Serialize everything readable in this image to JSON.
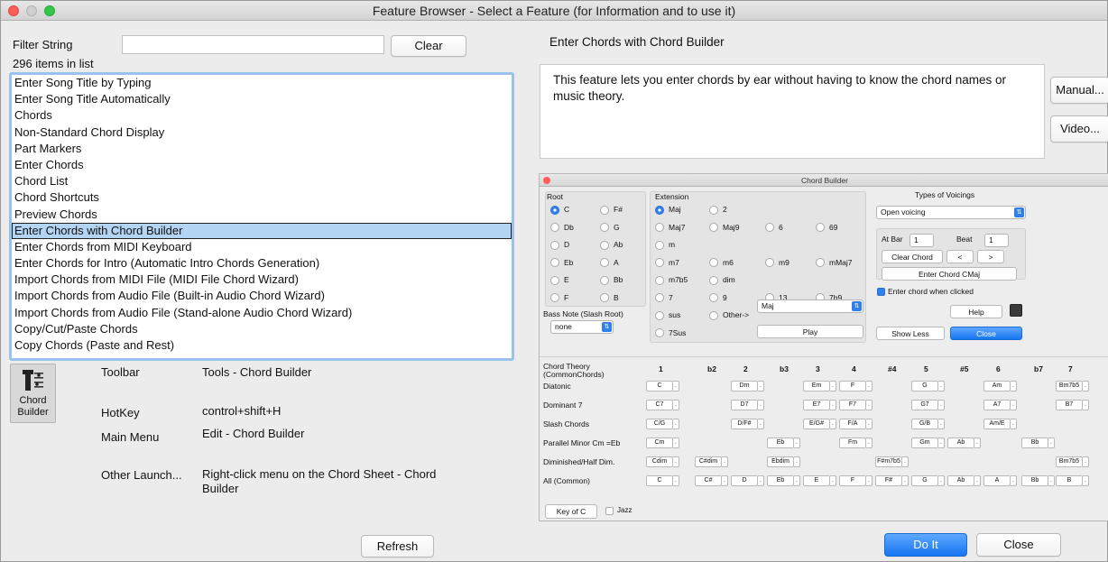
{
  "window": {
    "title": "Feature Browser - Select a Feature (for Information and to use it)"
  },
  "filter": {
    "label": "Filter String",
    "value": "",
    "clear_label": "Clear",
    "count_text": "296 items in list"
  },
  "feature_list": [
    "Enter Song Title by Typing",
    "Enter Song Title Automatically",
    "Chords",
    "Non-Standard Chord Display",
    "Part Markers",
    "Enter Chords",
    "Chord List",
    "Chord Shortcuts",
    "Preview Chords",
    "Enter Chords with Chord Builder",
    "Enter Chords from MIDI Keyboard",
    "Enter Chords for Intro (Automatic Intro Chords Generation)",
    "Import Chords from MIDI File (MIDI File Chord Wizard)",
    "Import Chords from Audio File (Built-in Audio Chord Wizard)",
    "Import Chords from Audio File (Stand-alone Audio Chord Wizard)",
    "Copy/Cut/Paste Chords",
    "Copy Chords (Paste and Rest)"
  ],
  "selected_index": 9,
  "detail": {
    "title": "Enter Chords with Chord Builder",
    "description": "This feature lets you enter chords by ear without having to know the chord names or music theory.",
    "manual_label": "Manual...",
    "video_label": "Video..."
  },
  "info": {
    "icon_label": "Chord Builder",
    "toolbar_label": "Toolbar",
    "toolbar_value": "Tools - Chord Builder",
    "hotkey_label": "HotKey",
    "hotkey_value": "control+shift+H",
    "mainmenu_label": "Main Menu",
    "mainmenu_value": "Edit - Chord Builder",
    "other_label": "Other Launch...",
    "other_value": "Right-click menu on the Chord Sheet - Chord Builder"
  },
  "buttons": {
    "refresh": "Refresh",
    "doit": "Do It",
    "close": "Close"
  },
  "chord_builder": {
    "title": "Chord Builder",
    "root_label": "Root",
    "roots": [
      "C",
      "F#",
      "Db",
      "G",
      "D",
      "Ab",
      "Eb",
      "A",
      "E",
      "Bb",
      "F",
      "B"
    ],
    "extension_label": "Extension",
    "extensions": [
      "Maj",
      "2",
      "Maj7",
      "Maj9",
      "6",
      "69",
      "m",
      "m7",
      "m6",
      "m9",
      "mMaj7",
      "m7b5",
      "dim",
      "7",
      "9",
      "13",
      "7b9",
      "sus",
      "Other->",
      "7Sus"
    ],
    "other_value": "Maj",
    "bass_label": "Bass Note (Slash Root)",
    "bass_value": "none",
    "play_label": "Play",
    "voicings_label": "Types of Voicings",
    "voicing_value": "Open voicing",
    "at_bar_label": "At Bar",
    "at_bar_value": "1",
    "beat_label": "Beat",
    "beat_value": "1",
    "clear_chord": "Clear Chord",
    "prev": "<",
    "next": ">",
    "enter_chord": "Enter Chord CMaj",
    "enter_when_clicked": "Enter chord when clicked",
    "help": "Help",
    "show_less": "Show Less",
    "close": "Close",
    "theory_label": "Chord Theory (CommonChords)",
    "degrees": [
      "1",
      "b2",
      "2",
      "b3",
      "3",
      "4",
      "#4",
      "5",
      "#5",
      "6",
      "b7",
      "7"
    ],
    "row_labels": [
      "Diatonic",
      "Dominant 7",
      "Slash Chords",
      "Parallel Minor Cm =Eb",
      "Diminished/Half Dim.",
      "All (Common)"
    ],
    "rows": [
      [
        "C",
        "",
        "Dm",
        "",
        "Em",
        "F",
        "",
        "G",
        "",
        "Am",
        "",
        "Bm7b5"
      ],
      [
        "C7",
        "",
        "D7",
        "",
        "E7",
        "F7",
        "",
        "G7",
        "",
        "A7",
        "",
        "B7"
      ],
      [
        "C/G",
        "",
        "D/F#",
        "",
        "E/G#",
        "F/A",
        "",
        "G/B",
        "",
        "Am/E",
        "",
        ""
      ],
      [
        "Cm",
        "",
        "",
        "Eb",
        "",
        "Fm",
        "",
        "Gm",
        "Ab",
        "",
        "Bb",
        ""
      ],
      [
        "Cdim",
        "C#dim",
        "",
        "Ebdim",
        "",
        "",
        "F#m7b5",
        "",
        "",
        "",
        "",
        "Bm7b5"
      ],
      [
        "C",
        "C#",
        "D",
        "Eb",
        "E",
        "F",
        "F#",
        "G",
        "Ab",
        "A",
        "Bb",
        "B"
      ]
    ],
    "key_label": "Key of C",
    "jazz_label": "Jazz"
  }
}
